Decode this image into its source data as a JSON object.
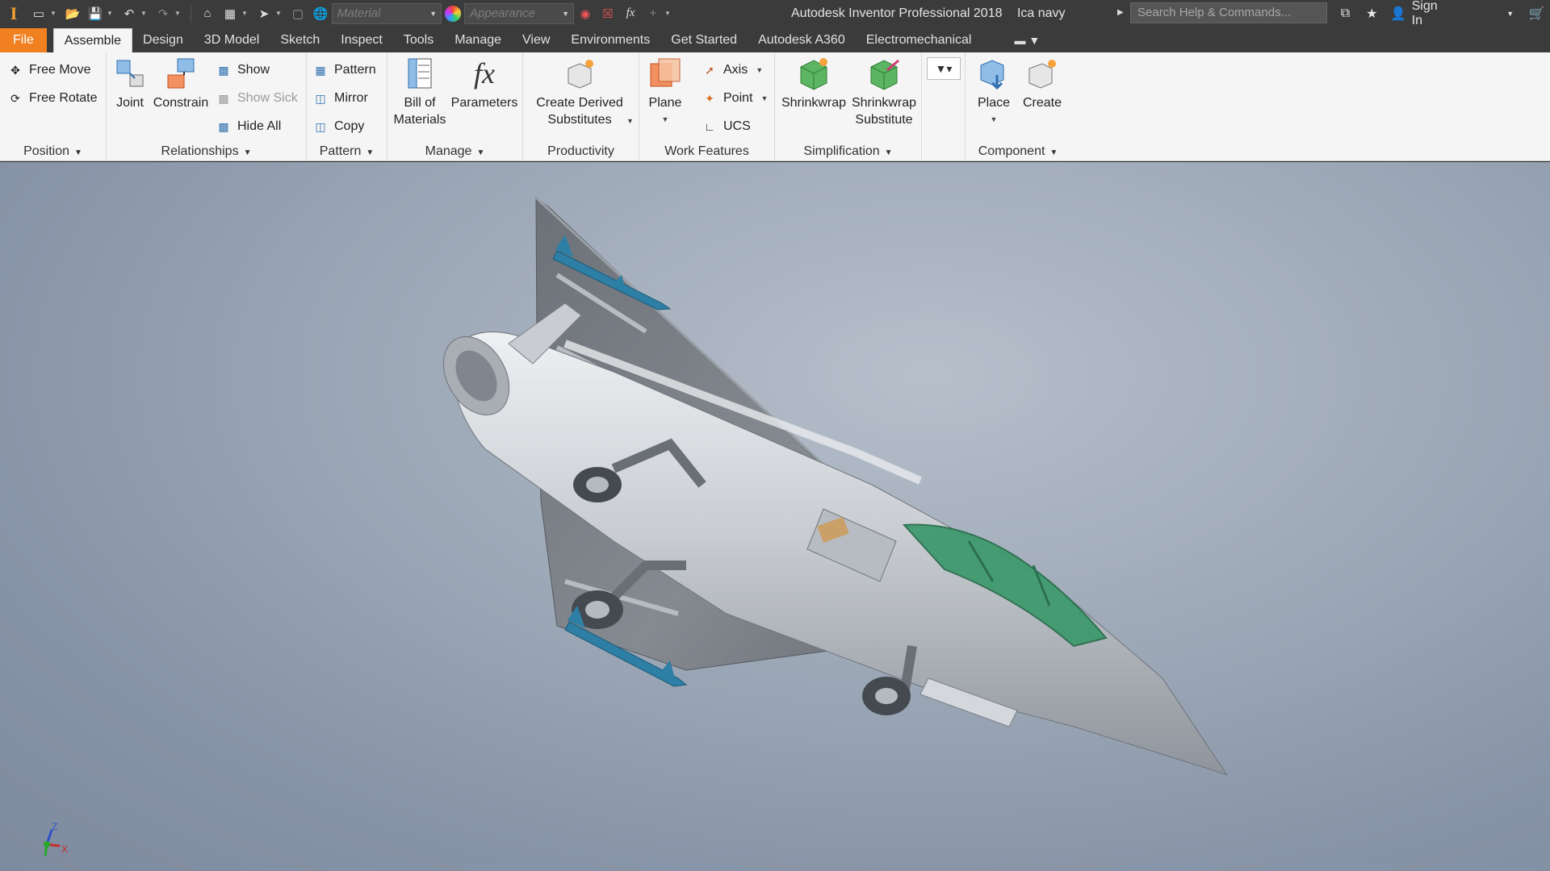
{
  "qat": {
    "logo_text": "I",
    "material_placeholder": "Material",
    "appearance_placeholder": "Appearance",
    "app_title": "Autodesk Inventor Professional 2018",
    "document_name": "Ica navy",
    "search_placeholder": "Search Help & Commands...",
    "sign_in": "Sign In"
  },
  "tabs": [
    {
      "label": "File"
    },
    {
      "label": "Assemble"
    },
    {
      "label": "Design"
    },
    {
      "label": "3D Model"
    },
    {
      "label": "Sketch"
    },
    {
      "label": "Inspect"
    },
    {
      "label": "Tools"
    },
    {
      "label": "Manage"
    },
    {
      "label": "View"
    },
    {
      "label": "Environments"
    },
    {
      "label": "Get Started"
    },
    {
      "label": "Autodesk A360"
    },
    {
      "label": "Electromechanical"
    }
  ],
  "ribbon": {
    "position": {
      "label": "Position",
      "free_move": "Free Move",
      "free_rotate": "Free Rotate"
    },
    "relationships": {
      "label": "Relationships",
      "joint": "Joint",
      "constrain": "Constrain",
      "show": "Show",
      "show_sick": "Show Sick",
      "hide_all": "Hide All"
    },
    "pattern": {
      "label": "Pattern",
      "pattern": "Pattern",
      "mirror": "Mirror",
      "copy": "Copy"
    },
    "manage": {
      "label": "Manage",
      "bom_line1": "Bill of",
      "bom_line2": "Materials",
      "parameters": "Parameters"
    },
    "productivity": {
      "label": "Productivity",
      "cds_line1": "Create Derived",
      "cds_line2": "Substitutes"
    },
    "work_features": {
      "label": "Work Features",
      "plane": "Plane",
      "axis": "Axis",
      "point": "Point",
      "ucs": "UCS"
    },
    "simplification": {
      "label": "Simplification",
      "shrinkwrap": "Shrinkwrap",
      "sws_line1": "Shrinkwrap",
      "sws_line2": "Substitute"
    },
    "component": {
      "label": "Component",
      "place": "Place",
      "create": "Create"
    }
  },
  "triad": {
    "z": "Z",
    "x": "X"
  },
  "colors": {
    "accent_file_tab": "#f08020",
    "ribbon_bg": "#f5f5f5",
    "titlebar_bg": "#3b3b3b",
    "canopy": "#3f9a6e",
    "missile": "#2d7fa6",
    "airframe": "#c9cdd2"
  }
}
